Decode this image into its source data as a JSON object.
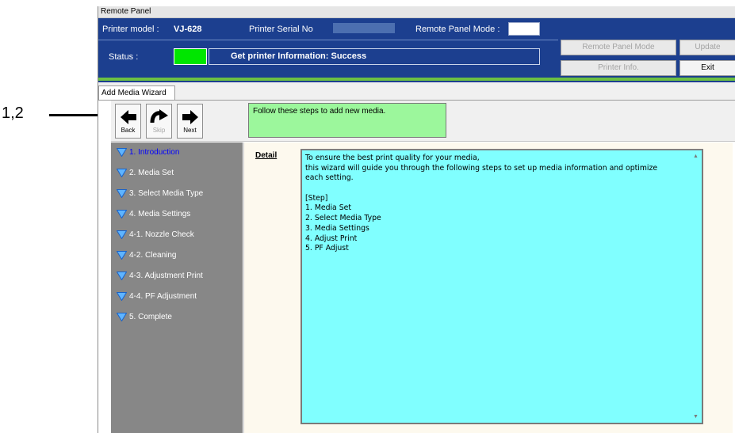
{
  "callout": {
    "label": "1,2"
  },
  "window": {
    "title": "Remote Panel"
  },
  "header": {
    "printer_model_label": "Printer model :",
    "printer_model_value": "VJ-628",
    "serial_label": "Printer Serial No",
    "remote_mode_label": "Remote Panel Mode :",
    "status_label": "Status :",
    "status_text": "Get printer Information: Success",
    "status_color": "#00e600",
    "buttons": {
      "remote_panel_mode": "Remote Panel Mode",
      "update": "Update",
      "printer_info": "Printer Info.",
      "exit": "Exit"
    }
  },
  "tab": {
    "label": "Add Media Wizard"
  },
  "toolbar": {
    "back": "Back",
    "skip": "Skip",
    "next": "Next",
    "instruction": "Follow these steps to add new media."
  },
  "steps": [
    {
      "label": "1. Introduction",
      "active": true
    },
    {
      "label": "2. Media Set"
    },
    {
      "label": "3. Select Media Type"
    },
    {
      "label": "4. Media Settings"
    },
    {
      "label": "4-1. Nozzle Check"
    },
    {
      "label": "4-2. Cleaning"
    },
    {
      "label": "4-3. Adjustment Print"
    },
    {
      "label": "4-4. PF Adjustment"
    },
    {
      "label": "5. Complete"
    }
  ],
  "detail": {
    "label": "Detail",
    "lines": [
      "To ensure the best print quality for your media,",
      "this wizard will guide you through the following steps to set up media information and optimize",
      "each setting.",
      "",
      "[Step]",
      "1. Media Set",
      "2. Select Media Type",
      "3. Media Settings",
      "4. Adjust Print",
      "5. PF Adjust"
    ]
  },
  "colors": {
    "header_bg": "#1c3f8f",
    "accent_green": "#6cc043",
    "instruction_bg": "#9cf79c",
    "detail_bg": "#80ffff",
    "steps_bg": "#878787",
    "active_step": "#0000ff"
  }
}
